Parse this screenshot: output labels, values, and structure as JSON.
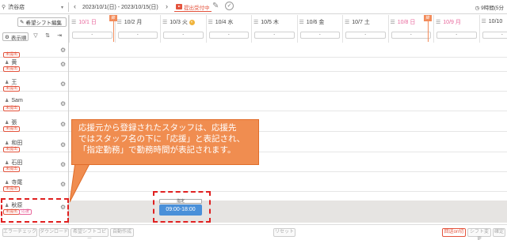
{
  "topbar": {
    "store": "渋谷店",
    "period": "2023/10/1(日) - 2023/10/15(日)",
    "status": "提出受付中",
    "clock": "9時間(5分"
  },
  "toolbar": {
    "request_shift_edit": "希望シフト編集",
    "sort_order": "表示順"
  },
  "days": [
    {
      "label": "10/1 日",
      "weekend": true,
      "dropdown": "-"
    },
    {
      "label": "10/2 月",
      "weekend": false,
      "dropdown": "-"
    },
    {
      "label": "10/3 火",
      "weekend": false,
      "dropdown": "-"
    },
    {
      "label": "10/4 水",
      "weekend": false,
      "dropdown": "-"
    },
    {
      "label": "10/5 木",
      "weekend": false,
      "dropdown": "-"
    },
    {
      "label": "10/6 金",
      "weekend": false,
      "dropdown": "-"
    },
    {
      "label": "10/7 土",
      "weekend": false,
      "dropdown": "-"
    },
    {
      "label": "10/8 日",
      "weekend": true,
      "dropdown": "-"
    },
    {
      "label": "10/9 月",
      "weekend": true,
      "dropdown": "-"
    },
    {
      "label": "10/10",
      "weekend": false,
      "dropdown": "-"
    }
  ],
  "flags": {
    "day1": "締",
    "day8": "締"
  },
  "staff": [
    {
      "name": "",
      "tag": "未提出"
    },
    {
      "name": "黄",
      "tag": "未提出"
    },
    {
      "name": "王",
      "tag": "未提出"
    },
    {
      "name": "Sam",
      "tag": "未提出"
    },
    {
      "name": "張",
      "tag": "未提出"
    },
    {
      "name": "和田",
      "tag": "未提出"
    },
    {
      "name": "石田",
      "tag": "未提出"
    },
    {
      "name": "寺尾",
      "tag": "未提出"
    },
    {
      "name": "秋原",
      "tag": "未提出",
      "tag2": "応援"
    }
  ],
  "shift": {
    "label": "指定",
    "time": "09:00-18:00"
  },
  "callout": {
    "line1": "応援元から登録されたスタッフは、応援先",
    "line2": "ではスタッフ名の下に「応援」と表記され、",
    "line3": "「指定勤務」で勤務時間が表記されます。"
  },
  "bottom": {
    "error_check": "エラーチェック",
    "download": "ダウンロード",
    "copy": "希望シフトコピー",
    "auto_create": "自動作成",
    "reset": "リセット",
    "submit_toggle": "回送on切",
    "shift_change": "シフト変更",
    "confirm": "確定"
  }
}
